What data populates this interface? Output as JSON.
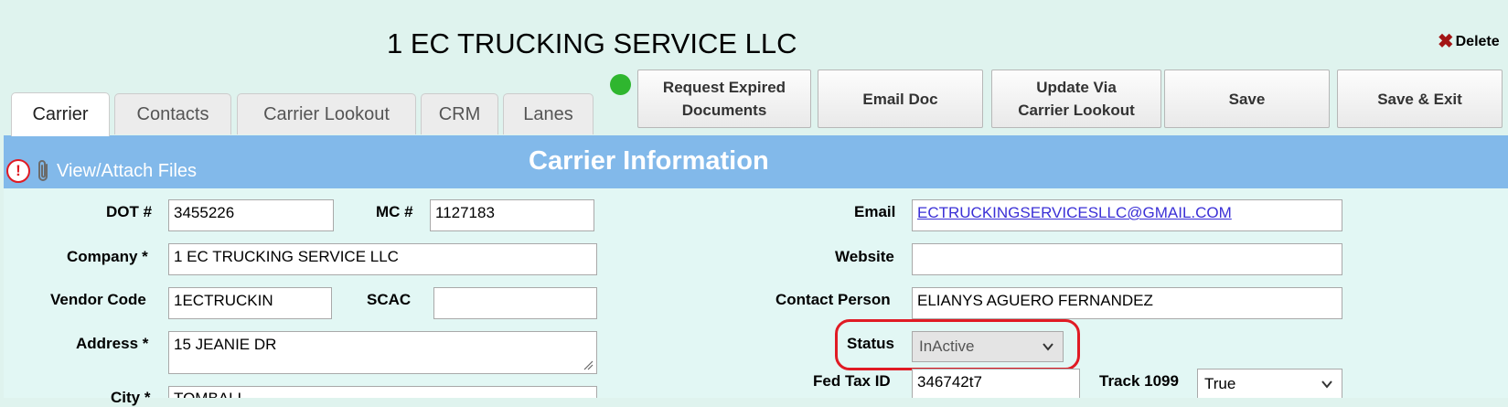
{
  "header": {
    "title": "1 EC TRUCKING SERVICE LLC",
    "delete_label": "Delete"
  },
  "toolbar": {
    "status_color": "#2fb62f",
    "buttons": [
      {
        "line1": "Request Expired",
        "line2": "Documents"
      },
      {
        "line1": "Email Doc",
        "line2": ""
      },
      {
        "line1": "Update Via",
        "line2": "Carrier Lookout"
      },
      {
        "line1": "Save",
        "line2": ""
      },
      {
        "line1": "Save & Exit",
        "line2": ""
      }
    ]
  },
  "tabs": [
    {
      "label": "Carrier",
      "active": true
    },
    {
      "label": "Contacts",
      "active": false
    },
    {
      "label": "Carrier Lookout",
      "active": false
    },
    {
      "label": "CRM",
      "active": false
    },
    {
      "label": "Lanes",
      "active": false
    }
  ],
  "section": {
    "title": "Carrier Information",
    "attach_label": "View/Attach Files",
    "band_color": "#82b9ea"
  },
  "form": {
    "dot": {
      "label": "DOT #",
      "value": "3455226"
    },
    "mc": {
      "label": "MC #",
      "value": "1127183"
    },
    "company": {
      "label": "Company *",
      "value": "1 EC TRUCKING SERVICE LLC"
    },
    "vendor_code": {
      "label": "Vendor Code",
      "value": "1ECTRUCKIN"
    },
    "scac": {
      "label": "SCAC",
      "value": ""
    },
    "address": {
      "label": "Address *",
      "value": "15 JEANIE DR"
    },
    "city": {
      "label": "City *",
      "value": "TOMBALL"
    },
    "email": {
      "label": "Email",
      "value": "ECTRUCKINGSERVICESLLC@GMAIL.COM"
    },
    "website": {
      "label": "Website",
      "value": ""
    },
    "contact_person": {
      "label": "Contact Person",
      "value": "ELIANYS AGUERO FERNANDEZ"
    },
    "status": {
      "label": "Status",
      "value": "InActive"
    },
    "fed_tax_id": {
      "label": "Fed Tax ID",
      "value": "346742t7"
    },
    "track_1099": {
      "label": "Track 1099",
      "value": "True"
    }
  },
  "annotation": {
    "color": "#e01b24"
  }
}
